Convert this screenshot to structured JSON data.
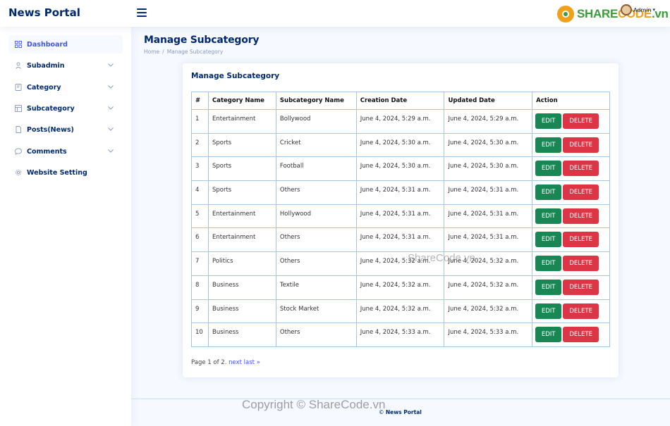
{
  "header": {
    "brand": "News Portal",
    "watermark_logo_share": "SHARE",
    "watermark_logo_code": "CODE",
    "watermark_logo_suffix": ".vn",
    "profile_name": "Admin"
  },
  "sidebar": {
    "items": [
      {
        "label": "Dashboard",
        "icon": "grid-icon",
        "active": true,
        "expandable": false
      },
      {
        "label": "Subadmin",
        "icon": "person-icon",
        "active": false,
        "expandable": true
      },
      {
        "label": "Category",
        "icon": "journal-icon",
        "active": false,
        "expandable": true
      },
      {
        "label": "Subcategory",
        "icon": "layout-icon",
        "active": false,
        "expandable": true
      },
      {
        "label": "Posts(News)",
        "icon": "document-icon",
        "active": false,
        "expandable": true
      },
      {
        "label": "Comments",
        "icon": "chat-icon",
        "active": false,
        "expandable": true
      },
      {
        "label": "Website Setting",
        "icon": "gear-icon",
        "active": false,
        "expandable": false
      }
    ]
  },
  "main": {
    "page_title": "Manage Subcategory",
    "breadcrumb": [
      "Home",
      "Manage Subcategory"
    ],
    "card_title": "Manage Subcategory",
    "table": {
      "headers": [
        "#",
        "Category Name",
        "Subcategory Name",
        "Creation Date",
        "Updated Date",
        "Action"
      ],
      "rows": [
        [
          "1",
          "Entertainment",
          "Bollywood",
          "June 4, 2024, 5:29 a.m.",
          "June 4, 2024, 5:29 a.m."
        ],
        [
          "2",
          "Sports",
          "Cricket",
          "June 4, 2024, 5:30 a.m.",
          "June 4, 2024, 5:30 a.m."
        ],
        [
          "3",
          "Sports",
          "Football",
          "June 4, 2024, 5:30 a.m.",
          "June 4, 2024, 5:30 a.m."
        ],
        [
          "4",
          "Sports",
          "Others",
          "June 4, 2024, 5:31 a.m.",
          "June 4, 2024, 5:31 a.m."
        ],
        [
          "5",
          "Entertainment",
          "Hollywood",
          "June 4, 2024, 5:31 a.m.",
          "June 4, 2024, 5:31 a.m."
        ],
        [
          "6",
          "Entertainment",
          "Others",
          "June 4, 2024, 5:31 a.m.",
          "June 4, 2024, 5:31 a.m."
        ],
        [
          "7",
          "Politics",
          "Others",
          "June 4, 2024, 5:32 a.m.",
          "June 4, 2024, 5:32 a.m."
        ],
        [
          "8",
          "Business",
          "Textile",
          "June 4, 2024, 5:32 a.m.",
          "June 4, 2024, 5:32 a.m."
        ],
        [
          "9",
          "Business",
          "Stock Market",
          "June 4, 2024, 5:32 a.m.",
          "June 4, 2024, 5:32 a.m."
        ],
        [
          "10",
          "Business",
          "Others",
          "June 4, 2024, 5:33 a.m.",
          "June 4, 2024, 5:33 a.m."
        ]
      ],
      "edit_label": "EDIT",
      "delete_label": "DELETE"
    },
    "pager": {
      "text": "Page 1 of 2.",
      "next_label": "next",
      "last_label": "last »"
    }
  },
  "watermark": {
    "center": "ShareCode.vn",
    "footer": "Copyright © ShareCode.vn"
  },
  "footer": {
    "copyright_symbol": "©",
    "copyright_name": "News Portal"
  },
  "colors": {
    "brand": "#012970",
    "accent": "#4154f1",
    "edit": "#198754",
    "delete": "#dc3545",
    "background": "#f6f9ff"
  }
}
